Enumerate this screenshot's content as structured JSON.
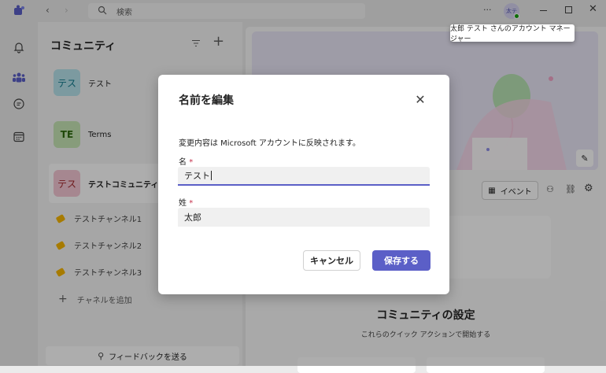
{
  "titlebar": {
    "search_placeholder": "検索",
    "more_label": "···",
    "user_initial": "太テ",
    "colors": {
      "accent": "#5b5fc7",
      "status": "#13a10e"
    }
  },
  "tooltip": {
    "text": "太郎 テスト さんのアカウント マネージャー"
  },
  "rail": {
    "icons": [
      "bell-icon",
      "people-icon",
      "chat-icon",
      "calendar-icon"
    ]
  },
  "panel": {
    "title": "コミュニティ",
    "communities": [
      {
        "avatar": "テス",
        "name": "テスト"
      },
      {
        "avatar": "TE",
        "name": "Terms"
      },
      {
        "avatar": "テス",
        "name": "テストコミュニティ"
      }
    ],
    "channels": [
      "テストチャンネル1",
      "テストチャンネル2",
      "テストチャンネル3"
    ],
    "add_channel": "チャネルを追加",
    "feedback": "フィードバックを送る"
  },
  "main": {
    "event_button": "イベント",
    "settings_title": "コミュニティの設定",
    "settings_subtitle": "これらのクイック アクションで開始する"
  },
  "dialog": {
    "title": "名前を編集",
    "description": "変更内容は Microsoft アカウントに反映されます。",
    "first_name_label": "名",
    "first_name_value": "テスト",
    "last_name_label": "姓",
    "last_name_value": "太郎",
    "required_mark": "*",
    "cancel_label": "キャンセル",
    "save_label": "保存する"
  }
}
